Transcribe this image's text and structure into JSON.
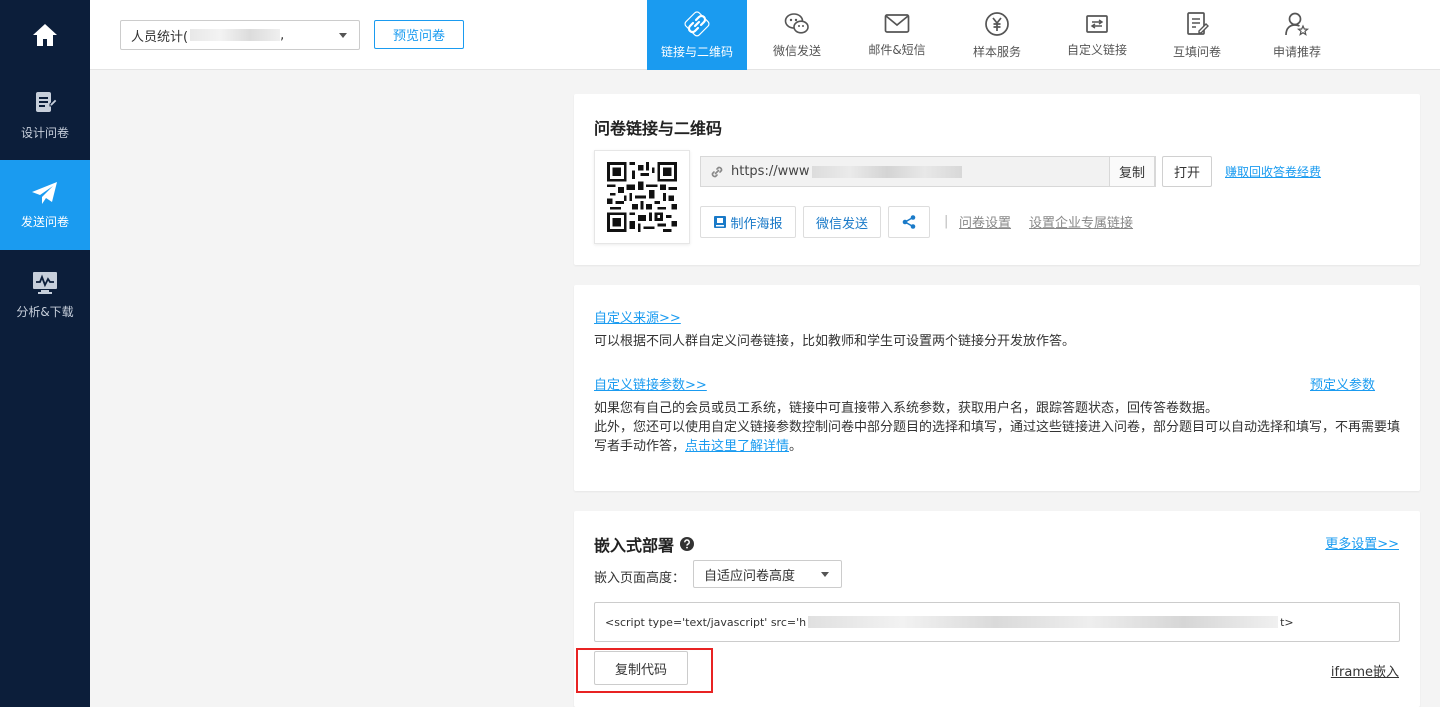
{
  "sidebar": {
    "home_icon": "home-icon",
    "items": [
      {
        "label": "设计问卷",
        "icon": "edit-doc-icon",
        "active": false
      },
      {
        "label": "发送问卷",
        "icon": "paper-plane-icon",
        "active": true
      },
      {
        "label": "分析&下载",
        "icon": "monitor-chart-icon",
        "active": false
      }
    ]
  },
  "topbar": {
    "survey_select_value": "人员统计(",
    "survey_select_suffix": ",",
    "preview_label": "预览问卷",
    "tabs": [
      {
        "label": "链接与二维码",
        "icon": "link-icon",
        "active": true
      },
      {
        "label": "微信发送",
        "icon": "wechat-icon",
        "active": false
      },
      {
        "label": "邮件&短信",
        "icon": "mail-icon",
        "active": false
      },
      {
        "label": "样本服务",
        "icon": "yen-icon",
        "active": false
      },
      {
        "label": "自定义链接",
        "icon": "custom-link-icon",
        "active": false
      },
      {
        "label": "互填问卷",
        "icon": "mutual-fill-icon",
        "active": false
      },
      {
        "label": "申请推荐",
        "icon": "user-star-icon",
        "active": false
      }
    ]
  },
  "link_card": {
    "title": "问卷链接与二维码",
    "url_prefix": "https://www",
    "copy_label": "复制",
    "open_label": "打开",
    "earn_link": "赚取回收答卷经费",
    "poster_label": "制作海报",
    "wechat_label": "微信发送",
    "share_icon": "share-icon",
    "separator": "|",
    "settings_link": "问卷设置",
    "enterprise_link": "设置企业专属链接"
  },
  "custom_card": {
    "source_link": "自定义来源>>",
    "source_desc": "可以根据不同人群自定义问卷链接，比如教师和学生可设置两个链接分开发放作答。",
    "params_link": "自定义链接参数>>",
    "predefined_link": "预定义参数",
    "params_desc_1": "如果您有自己的会员或员工系统，链接中可直接带入系统参数，获取用户名，跟踪答题状态，回传答卷数据。",
    "params_desc_2": "此外，您还可以使用自定义链接参数控制问卷中部分题目的选择和填写，通过这些链接进入问卷，部分题目可以自动选择和填写，不再需要填写者手动作答，",
    "details_link": "点击这里了解详情",
    "period": "。"
  },
  "embed_card": {
    "title": "嵌入式部署",
    "more_link": "更多设置>>",
    "height_label": "嵌入页面高度：",
    "height_value": "自适应问卷高度",
    "code_start": "<script type='text/javascript' src='h",
    "code_end": "t>",
    "copy_code_label": "复制代码",
    "iframe_link": "iframe嵌入"
  },
  "colors": {
    "sidebar_bg": "#0c1e3a",
    "accent": "#1a9bf0",
    "highlight": "#e82323"
  }
}
